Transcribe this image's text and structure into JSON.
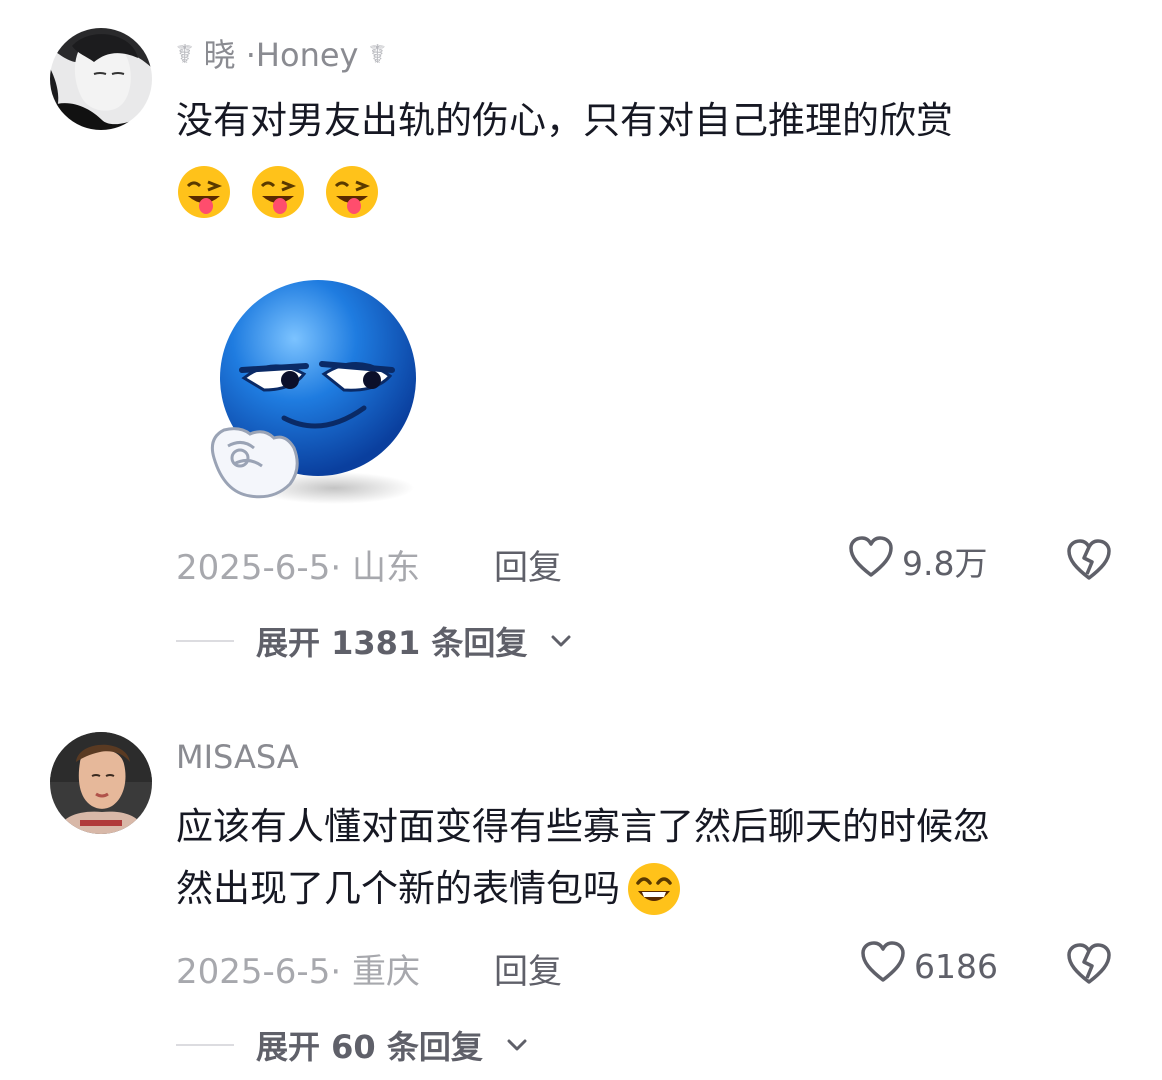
{
  "comments": [
    {
      "username": "晓 ·Honey",
      "username_decor": "☤",
      "text": "没有对男友出轨的伤心，只有对自己推理的欣赏",
      "emojis": [
        "grinning-tongue-wink-emoji",
        "grinning-tongue-wink-emoji",
        "grinning-tongue-wink-emoji"
      ],
      "sticker": "blue-smirk-face-sticker",
      "date_location": "2025-6-5· 山东",
      "reply_label": "回复",
      "likes": "9.8万",
      "expand_label": "展开 1381 条回复"
    },
    {
      "username": "MISASA",
      "text_line1": "应该有人懂对面变得有些寡言了然后聊天的时候忽",
      "text_line2": "然出现了几个新的表情包吗",
      "emoji": "smiling-face-emoji",
      "date_location": "2025-6-5· 重庆",
      "reply_label": "回复",
      "likes": "6186",
      "expand_label": "展开 60 条回复"
    }
  ],
  "colors": {
    "primary_text": "#161823",
    "secondary_text": "#5f6069",
    "muted_text": "#a7a8ad",
    "sticker_blue": "#1a6fd6"
  },
  "icons": [
    "heart-outline-icon",
    "broken-heart-icon",
    "chevron-down-icon"
  ]
}
